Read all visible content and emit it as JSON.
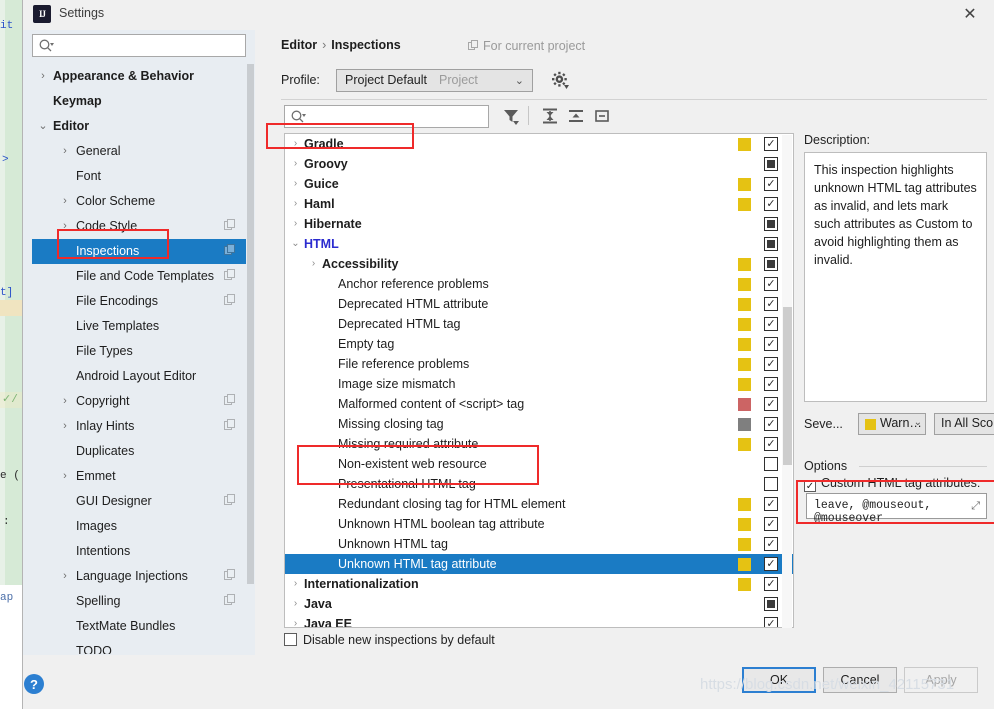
{
  "window": {
    "title": "Settings",
    "app_icon": "IJ",
    "close_icon": "✕"
  },
  "nav": {
    "search_placeholder": "",
    "search_icon": "search-icon",
    "items": [
      {
        "label": "Appearance & Behavior",
        "level": 0,
        "arrow": "›",
        "copy": false,
        "selected": false
      },
      {
        "label": "Keymap",
        "level": 0,
        "arrow": "",
        "copy": false,
        "selected": false
      },
      {
        "label": "Editor",
        "level": 0,
        "arrow": "⌄",
        "copy": false,
        "selected": false
      },
      {
        "label": "General",
        "level": 1,
        "arrow": "›",
        "copy": false,
        "selected": false
      },
      {
        "label": "Font",
        "level": 1,
        "arrow": "",
        "copy": false,
        "selected": false
      },
      {
        "label": "Color Scheme",
        "level": 1,
        "arrow": "›",
        "copy": false,
        "selected": false
      },
      {
        "label": "Code Style",
        "level": 1,
        "arrow": "›",
        "copy": true,
        "selected": false
      },
      {
        "label": "Inspections",
        "level": 1,
        "arrow": "",
        "copy": true,
        "selected": true
      },
      {
        "label": "File and Code Templates",
        "level": 1,
        "arrow": "",
        "copy": true,
        "selected": false
      },
      {
        "label": "File Encodings",
        "level": 1,
        "arrow": "",
        "copy": true,
        "selected": false
      },
      {
        "label": "Live Templates",
        "level": 1,
        "arrow": "",
        "copy": false,
        "selected": false
      },
      {
        "label": "File Types",
        "level": 1,
        "arrow": "",
        "copy": false,
        "selected": false
      },
      {
        "label": "Android Layout Editor",
        "level": 1,
        "arrow": "",
        "copy": false,
        "selected": false
      },
      {
        "label": "Copyright",
        "level": 1,
        "arrow": "›",
        "copy": true,
        "selected": false
      },
      {
        "label": "Inlay Hints",
        "level": 1,
        "arrow": "›",
        "copy": true,
        "selected": false
      },
      {
        "label": "Duplicates",
        "level": 1,
        "arrow": "",
        "copy": false,
        "selected": false
      },
      {
        "label": "Emmet",
        "level": 1,
        "arrow": "›",
        "copy": false,
        "selected": false
      },
      {
        "label": "GUI Designer",
        "level": 1,
        "arrow": "",
        "copy": true,
        "selected": false
      },
      {
        "label": "Images",
        "level": 1,
        "arrow": "",
        "copy": false,
        "selected": false
      },
      {
        "label": "Intentions",
        "level": 1,
        "arrow": "",
        "copy": false,
        "selected": false
      },
      {
        "label": "Language Injections",
        "level": 1,
        "arrow": "›",
        "copy": true,
        "selected": false
      },
      {
        "label": "Spelling",
        "level": 1,
        "arrow": "",
        "copy": true,
        "selected": false
      },
      {
        "label": "TextMate Bundles",
        "level": 1,
        "arrow": "",
        "copy": false,
        "selected": false
      },
      {
        "label": "TODO",
        "level": 1,
        "arrow": "",
        "copy": false,
        "selected": false
      }
    ]
  },
  "content": {
    "breadcrumb": {
      "parent": "Editor",
      "separator": "›",
      "current": "Inspections"
    },
    "for_current_project": "For current project",
    "profile": {
      "label": "Profile:",
      "value": "Project Default",
      "kind": "Project",
      "chevron": "⌄",
      "gear_icon": "gear-icon"
    },
    "tree_search_placeholder": "",
    "toolbar": {
      "filter_icon": "filter-icon",
      "expand_all_icon": "expand-all-icon",
      "collapse_all_icon": "collapse-all-icon",
      "reset_icon": "reset-icon"
    },
    "disable_new": "Disable new inspections by default"
  },
  "tree": {
    "check_mark": "✓",
    "rows": [
      {
        "label": "Gradle",
        "level": 0,
        "arrow": "›",
        "severity": "#e5c213",
        "checkbox": "checked",
        "selected": false,
        "highlight": false
      },
      {
        "label": "Groovy",
        "level": 0,
        "arrow": "›",
        "severity": "",
        "checkbox": "partial",
        "selected": false,
        "highlight": false
      },
      {
        "label": "Guice",
        "level": 0,
        "arrow": "›",
        "severity": "#e5c213",
        "checkbox": "checked",
        "selected": false,
        "highlight": false
      },
      {
        "label": "Haml",
        "level": 0,
        "arrow": "›",
        "severity": "#e5c213",
        "checkbox": "checked",
        "selected": false,
        "highlight": false
      },
      {
        "label": "Hibernate",
        "level": 0,
        "arrow": "›",
        "severity": "",
        "checkbox": "partial",
        "selected": false,
        "highlight": false
      },
      {
        "label": "HTML",
        "level": 0,
        "arrow": "⌄",
        "severity": "",
        "checkbox": "partial",
        "selected": false,
        "highlight": true
      },
      {
        "label": "Accessibility",
        "level": 1,
        "arrow": "›",
        "severity": "#e5c213",
        "checkbox": "partial",
        "selected": false,
        "highlight": false
      },
      {
        "label": "Anchor reference problems",
        "level": 2,
        "arrow": "",
        "severity": "#e5c213",
        "checkbox": "checked",
        "selected": false,
        "highlight": false
      },
      {
        "label": "Deprecated HTML attribute",
        "level": 2,
        "arrow": "",
        "severity": "#e5c213",
        "checkbox": "checked",
        "selected": false,
        "highlight": false
      },
      {
        "label": "Deprecated HTML tag",
        "level": 2,
        "arrow": "",
        "severity": "#e5c213",
        "checkbox": "checked",
        "selected": false,
        "highlight": false
      },
      {
        "label": "Empty tag",
        "level": 2,
        "arrow": "",
        "severity": "#e5c213",
        "checkbox": "checked",
        "selected": false,
        "highlight": false
      },
      {
        "label": "File reference problems",
        "level": 2,
        "arrow": "",
        "severity": "#e5c213",
        "checkbox": "checked",
        "selected": false,
        "highlight": false
      },
      {
        "label": "Image size mismatch",
        "level": 2,
        "arrow": "",
        "severity": "#e5c213",
        "checkbox": "checked",
        "selected": false,
        "highlight": false
      },
      {
        "label": "Malformed content of <script> tag",
        "level": 2,
        "arrow": "",
        "severity": "#cc6464",
        "checkbox": "checked",
        "selected": false,
        "highlight": false
      },
      {
        "label": "Missing closing tag",
        "level": 2,
        "arrow": "",
        "severity": "#7f7f7f",
        "checkbox": "checked",
        "selected": false,
        "highlight": false
      },
      {
        "label": "Missing required attribute",
        "level": 2,
        "arrow": "",
        "severity": "#e5c213",
        "checkbox": "checked",
        "selected": false,
        "highlight": false
      },
      {
        "label": "Non-existent web resource",
        "level": 2,
        "arrow": "",
        "severity": "",
        "checkbox": "empty",
        "selected": false,
        "highlight": false
      },
      {
        "label": "Presentational HTML tag",
        "level": 2,
        "arrow": "",
        "severity": "",
        "checkbox": "empty",
        "selected": false,
        "highlight": false
      },
      {
        "label": "Redundant closing tag for HTML element",
        "level": 2,
        "arrow": "",
        "severity": "#e5c213",
        "checkbox": "checked",
        "selected": false,
        "highlight": false
      },
      {
        "label": "Unknown HTML boolean tag attribute",
        "level": 2,
        "arrow": "",
        "severity": "#e5c213",
        "checkbox": "checked",
        "selected": false,
        "highlight": false
      },
      {
        "label": "Unknown HTML tag",
        "level": 2,
        "arrow": "",
        "severity": "#e5c213",
        "checkbox": "checked",
        "selected": false,
        "highlight": true
      },
      {
        "label": "Unknown HTML tag attribute",
        "level": 2,
        "arrow": "",
        "severity": "#e5c213",
        "checkbox": "checked",
        "selected": true,
        "highlight": true
      },
      {
        "label": "Internationalization",
        "level": 0,
        "arrow": "›",
        "severity": "#e5c213",
        "checkbox": "checked",
        "selected": false,
        "highlight": false
      },
      {
        "label": "Java",
        "level": 0,
        "arrow": "›",
        "severity": "",
        "checkbox": "partial",
        "selected": false,
        "highlight": false
      },
      {
        "label": "Java EE",
        "level": 0,
        "arrow": "›",
        "severity": "",
        "checkbox": "checked",
        "selected": false,
        "highlight": false
      }
    ]
  },
  "description": {
    "label": "Description:",
    "text": "This inspection highlights unknown HTML tag attributes as invalid, and lets mark such attributes as Custom to avoid highlighting them as invalid."
  },
  "severity": {
    "label": "Seve...",
    "value": "Warn…",
    "color": "#e5c213",
    "scope": "In All Sco…",
    "chevron": "⌄"
  },
  "options": {
    "label": "Options",
    "checkbox_label": "Custom HTML tag attributes:",
    "checkbox_state": "✓",
    "field_value": "leave, @mouseout, @mouseover",
    "expand_icon": "expand-icon"
  },
  "footer": {
    "help_icon": "?",
    "ok": "OK",
    "cancel": "Cancel",
    "apply": "Apply"
  },
  "watermark": "https://blog.csdn.net/weixin_42115731",
  "background_code": [
    "it",
    "]",
    "t]",
    "/",
    "e (",
    ":",
    "ap"
  ]
}
